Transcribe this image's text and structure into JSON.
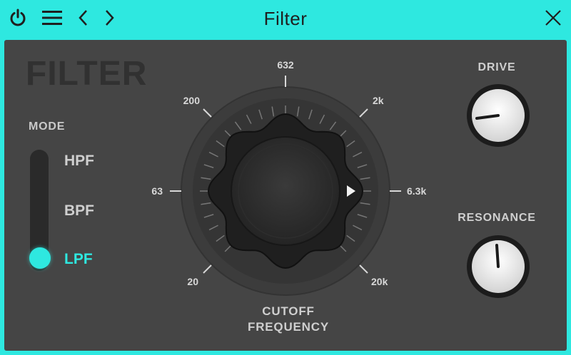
{
  "window": {
    "title": "Filter"
  },
  "toolbar": {
    "power_icon": "power-icon",
    "menu_icon": "hamburger-menu-icon",
    "back_icon": "chevron-left-icon",
    "forward_icon": "chevron-right-icon",
    "close_icon": "close-icon"
  },
  "plugin": {
    "brand": "FILTER",
    "mode": {
      "label": "MODE",
      "options": [
        "HPF",
        "BPF",
        "LPF"
      ],
      "selected": "LPF"
    },
    "cutoff": {
      "label_line1": "CUTOFF",
      "label_line2": "FREQUENCY",
      "scale_labels": [
        "20",
        "63",
        "200",
        "632",
        "2k",
        "6.3k",
        "20k"
      ],
      "value": "6.3k"
    },
    "drive": {
      "label": "DRIVE"
    },
    "resonance": {
      "label": "RESONANCE"
    }
  },
  "colors": {
    "accent": "#2ee8e0",
    "panel": "#454545",
    "text": "#cfcfcf"
  }
}
